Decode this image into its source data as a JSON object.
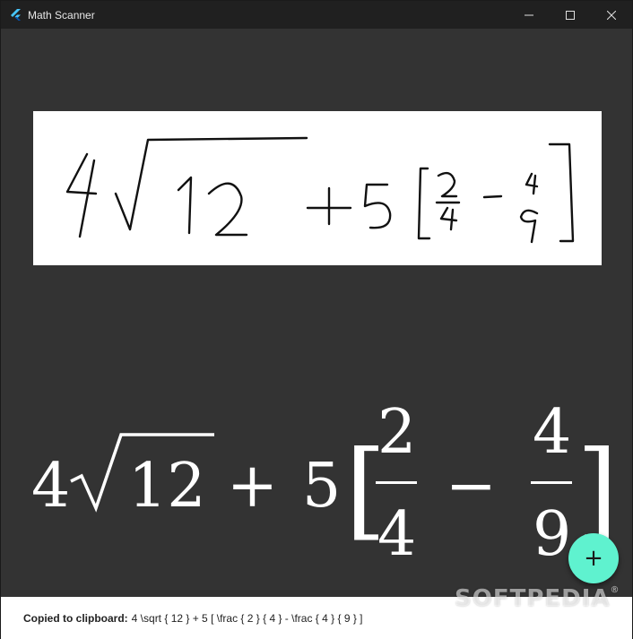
{
  "window": {
    "title": "Math Scanner"
  },
  "rendered_equation": {
    "coefficient": "4",
    "radicand": "12",
    "plus": "+",
    "five": "5",
    "left_bracket": "[",
    "frac1_num": "2",
    "frac1_den": "4",
    "minus": "−",
    "frac2_num": "4",
    "frac2_den": "9",
    "right_bracket": "]"
  },
  "fab": {
    "icon": "plus-icon",
    "label": "+",
    "color": "#5ff2cf"
  },
  "snackbar": {
    "label": "Copied to clipboard:",
    "value": "4 \\sqrt { 12 } + 5 [ \\frac { 2 } { 4 } - \\frac { 4 } { 9 } ]"
  },
  "watermark": {
    "text": "SOFTPEDIA",
    "mark": "®"
  },
  "colors": {
    "background": "#333333",
    "titlebar": "#202020",
    "accent": "#5ff2cf"
  }
}
